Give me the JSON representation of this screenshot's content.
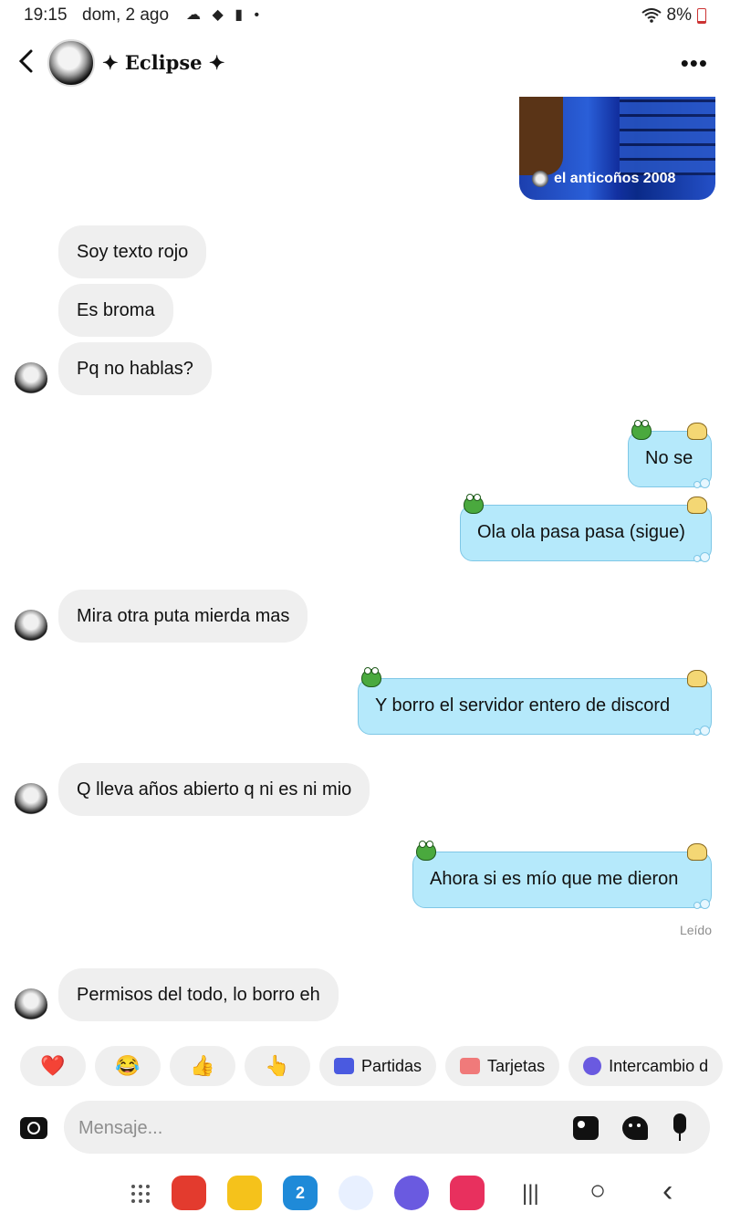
{
  "status_bar": {
    "time": "19:15",
    "date": "dom, 2 ago",
    "notification_icons": "☁ ◆ ▮ •",
    "battery": "8%"
  },
  "header": {
    "title": "✦ Eclipse ✦",
    "more": "•••"
  },
  "shared_media": {
    "caption": "el anticoños 2008"
  },
  "messages": {
    "m1": "Soy texto rojo",
    "m2": "Es broma",
    "m3": "Pq no hablas?",
    "m4": "No se",
    "m5": "Ola ola pasa pasa (sigue)",
    "m6": "Mira otra puta mierda mas",
    "m7": "Y borro el servidor entero de discord",
    "m8": "Q lleva años abierto q ni es ni mio",
    "m9": "Ahora si es mío que me dieron",
    "m10": "Permisos del todo, lo borro eh"
  },
  "seen_label": "Leído",
  "quick_replies": {
    "heart": "❤️",
    "laugh": "😂",
    "thumbs": "👍",
    "point": "👆",
    "games": "Partidas",
    "cards": "Tarjetas",
    "exchange": "Intercambio d"
  },
  "composer": {
    "placeholder": "Mensaje..."
  },
  "nav": {
    "calendar_day": "2",
    "recents": "|||",
    "home": "○",
    "back": "‹"
  },
  "colors": {
    "outgoing_bubble": "#b5e9fb",
    "incoming_bubble": "#efefef"
  }
}
